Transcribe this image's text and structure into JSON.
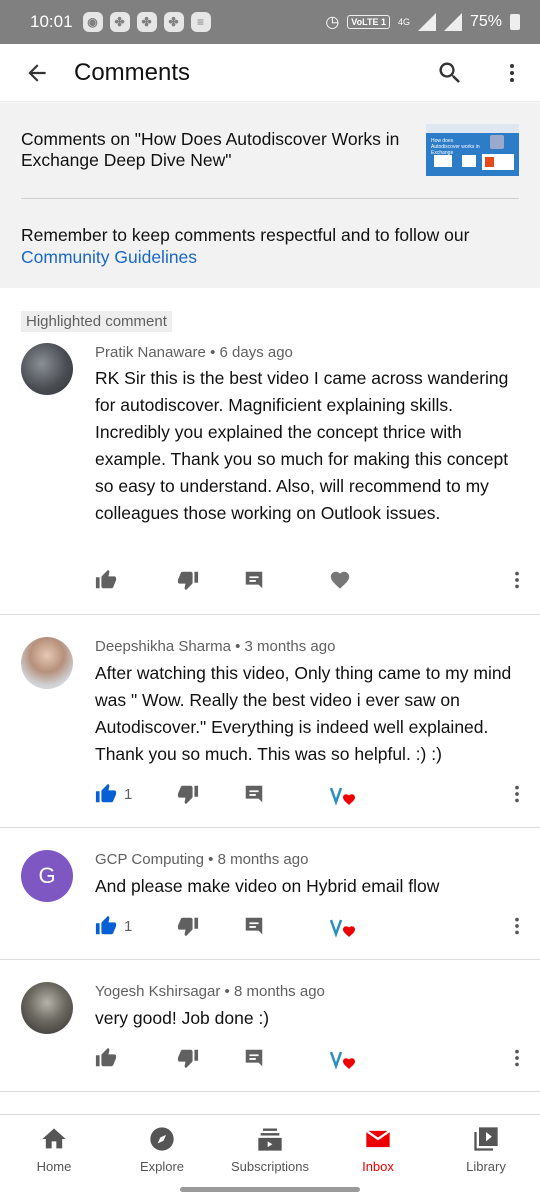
{
  "status_bar": {
    "time": "10:01",
    "volte": "VoLTE 1",
    "network": "4G",
    "battery": "75%"
  },
  "app_bar": {
    "title": "Comments"
  },
  "video": {
    "title": "Comments on \"How Does Autodiscover Works in Exchange Deep Dive  New\"",
    "thumbnail_text": "How does Autodiscover works in Exchange",
    "notice_text": "Remember to keep comments respectful and to follow our",
    "guidelines_link": "Community Guidelines"
  },
  "highlight_label": "Highlighted comment",
  "comments": [
    {
      "author": "Pratik Nanaware",
      "time": "6 days ago",
      "text": "RK Sir this is the best video I came across wandering for autodiscover. Magnificient explaining skills. Incredibly you explained the concept thrice with example. Thank you so much for making this concept so easy to understand. Also, will recommend to my colleagues those working on Outlook issues.",
      "likes": "",
      "liked": false,
      "creator_hearted": false
    },
    {
      "author": "Deepshikha Sharma",
      "time": "3 months ago",
      "text": "After watching this video, Only thing came to my mind was \" Wow. Really the best video i ever saw on Autodiscover.\" Everything is indeed well explained. Thank you so much. This was so helpful.   :) :)",
      "likes": "1",
      "liked": true,
      "creator_hearted": true
    },
    {
      "author": "GCP Computing",
      "avatar_letter": "G",
      "time": "8 months ago",
      "text": "And please make video on Hybrid email flow",
      "likes": "1",
      "liked": true,
      "creator_hearted": true
    },
    {
      "author": "Yogesh Kshirsagar",
      "time": "8 months ago",
      "text": "very good! Job done :)",
      "likes": "",
      "liked": false,
      "creator_hearted": true
    }
  ],
  "separator": "•",
  "bottom_nav": [
    {
      "label": "Home",
      "icon": "home-icon"
    },
    {
      "label": "Explore",
      "icon": "compass-icon"
    },
    {
      "label": "Subscriptions",
      "icon": "subscriptions-icon"
    },
    {
      "label": "Inbox",
      "icon": "inbox-icon",
      "active": true
    },
    {
      "label": "Library",
      "icon": "library-icon"
    }
  ],
  "colors": {
    "accent_blue": "#065fd4",
    "link_blue": "#1a66c9",
    "inbox_red": "#e00000",
    "avatar_purple": "#7e57c2"
  }
}
